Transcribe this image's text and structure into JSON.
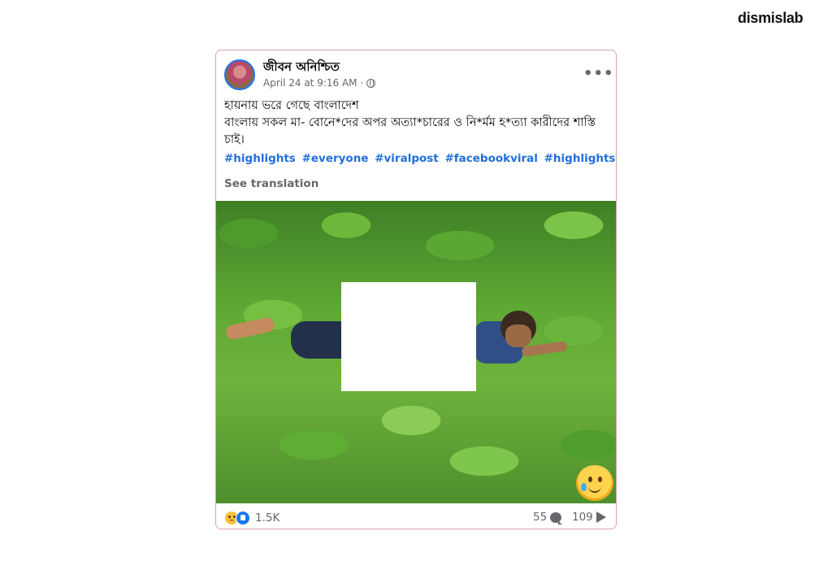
{
  "brand": {
    "logo_text": "dismislab"
  },
  "post": {
    "author": "জীবন অনিশ্চিত",
    "timestamp": "April 24 at 9:16 AM",
    "separator": "·",
    "privacy_icon": "globe-icon",
    "more_icon": "more-options-icon",
    "text_lines": [
      "হায়নায় ভরে গেছে বাংলাদেশ",
      "বাংলায় সকল মা- বোনে*দের অপর অত্যা*চারের ও নি*র্মম হ*ত্যা কারীদের শাস্তি চাই।"
    ],
    "hashtags": [
      "#highlights",
      "#everyone",
      "#viralpost",
      "#facebookviral",
      "#highlightseveryone"
    ],
    "see_translation": "See translation"
  },
  "footer": {
    "reaction_icons": [
      "sad-reaction-icon",
      "like-reaction-icon"
    ],
    "reaction_count": "1.5K",
    "comment_count": "55",
    "share_count": "109"
  },
  "colors": {
    "link": "#216fdb",
    "muted": "#65676b",
    "card_border": "#d9a5a5",
    "like_blue": "#1877f2"
  }
}
